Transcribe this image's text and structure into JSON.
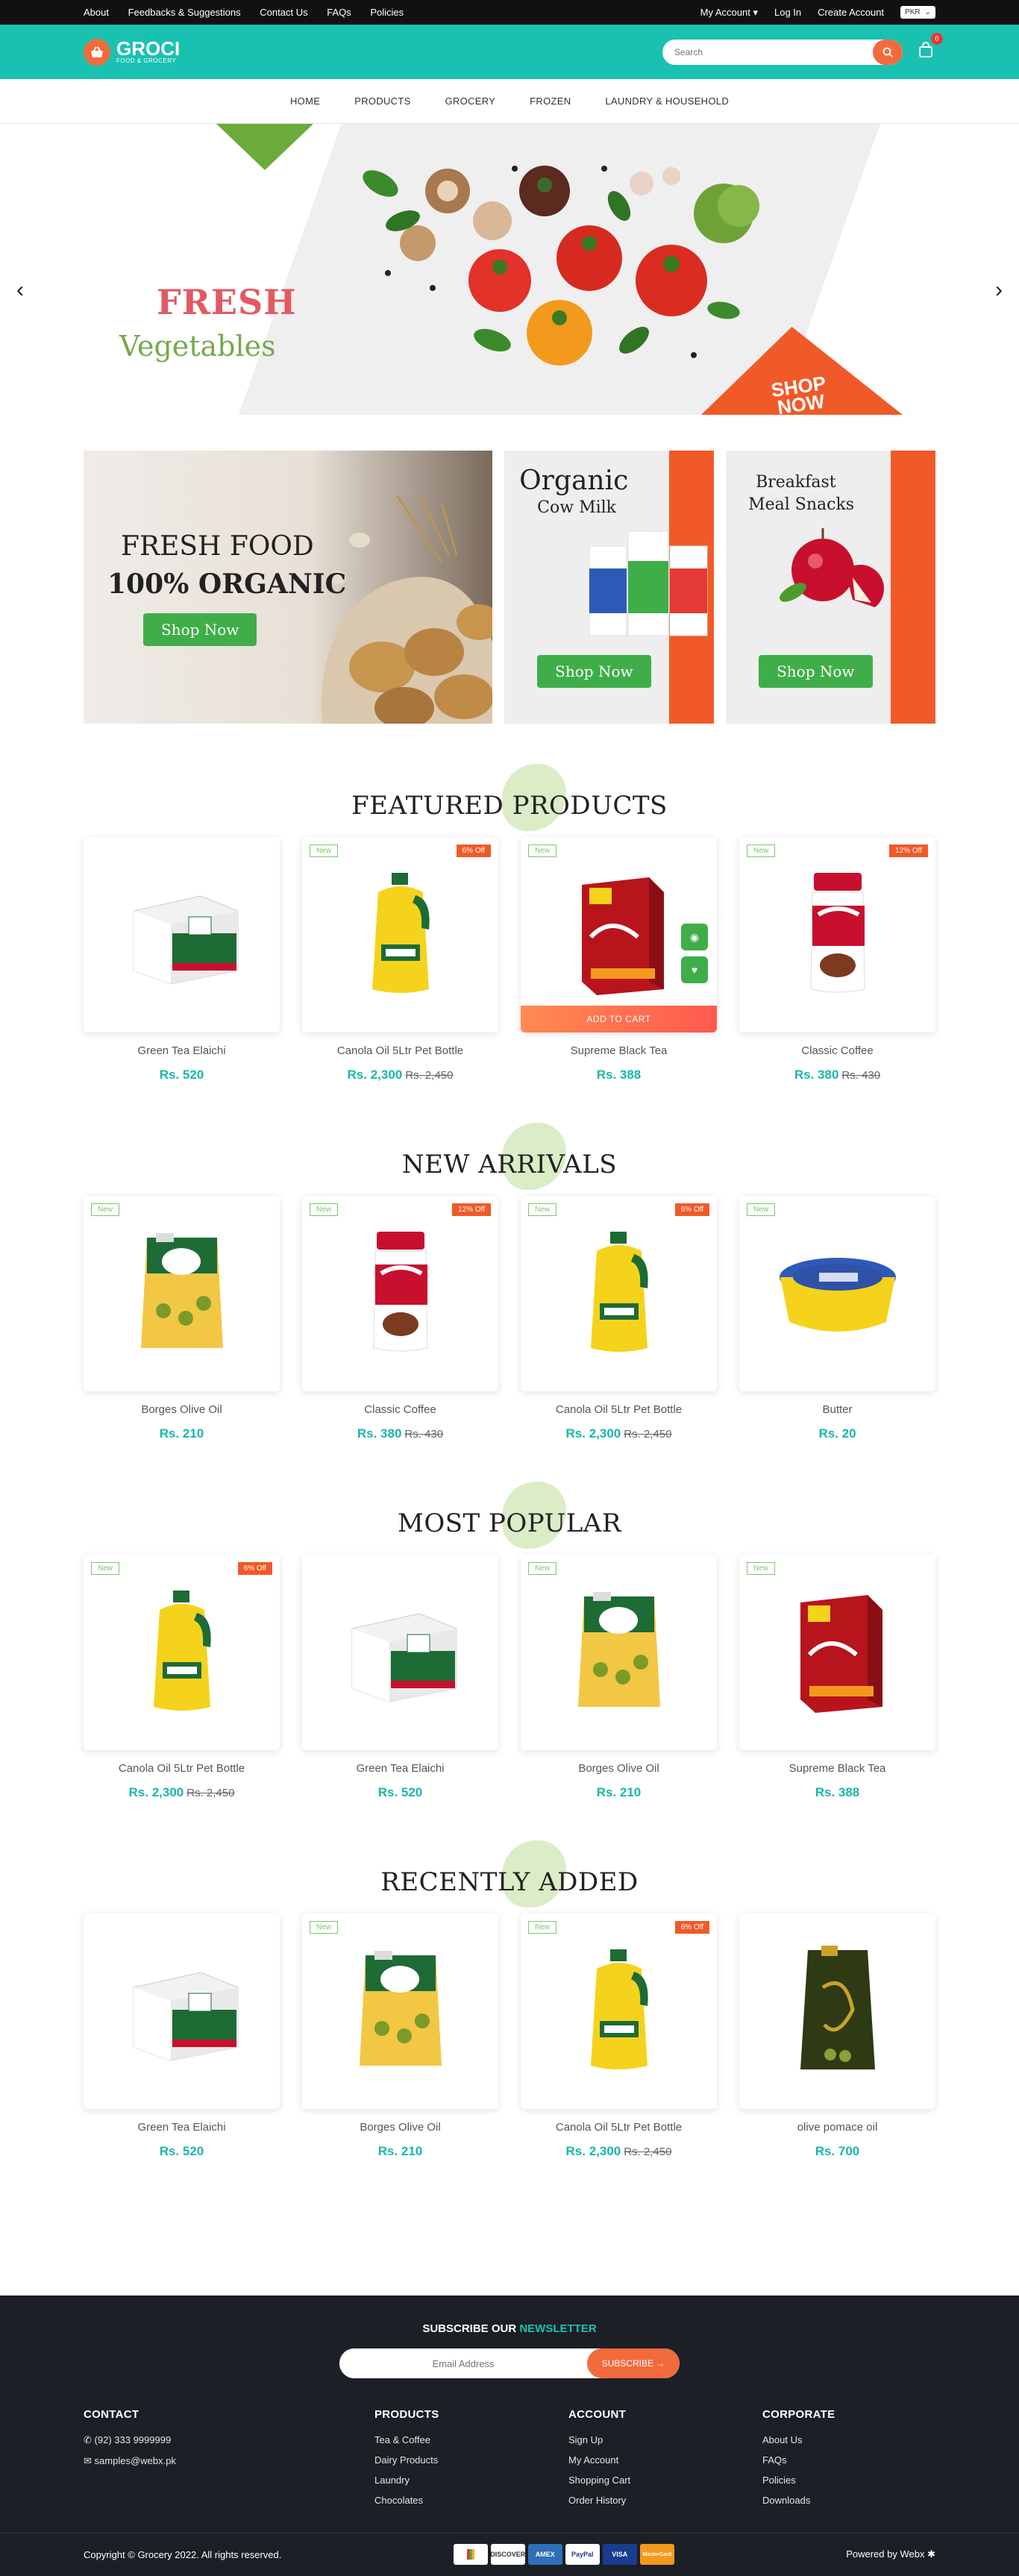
{
  "topbar": {
    "links": [
      "About",
      "Feedbacks & Suggestions",
      "Contact Us",
      "FAQs",
      "Policies"
    ],
    "my_account": "My Account",
    "login": "Log In",
    "create_account": "Create Account",
    "currency": "PKR"
  },
  "header": {
    "logo_name": "GROCI",
    "logo_sub": "FOOD & GROCERY",
    "search_placeholder": "Search",
    "cart_count": "0"
  },
  "nav": [
    "HOME",
    "PRODUCTS",
    "GROCERY",
    "FROZEN",
    "LAUNDRY & HOUSEHOLD"
  ],
  "hero": {
    "title": "FRESH",
    "subtitle": "Vegetables",
    "cta": "SHOP NOW"
  },
  "promos": [
    {
      "line1": "FRESH FOOD",
      "line2": "100% ORGANIC",
      "button": "Shop Now"
    },
    {
      "line1": "Organic",
      "line2": "Cow Milk",
      "button": "Shop Now"
    },
    {
      "line1": "Breakfast",
      "line2": "Meal Snacks",
      "button": "Shop Now"
    }
  ],
  "labels": {
    "add_to_cart": "ADD TO CART"
  },
  "sections": [
    {
      "title": "FEATURED PRODUCTS",
      "products": [
        {
          "name": "Green Tea Elaichi",
          "price": "Rs. 520",
          "old": "",
          "new": "",
          "off": "",
          "img": "butter-box"
        },
        {
          "name": "Canola Oil 5Ltr Pet Bottle",
          "price": "Rs. 2,300",
          "old": "Rs. 2,450",
          "new": "New",
          "off": "6% Off",
          "img": "oil-bottle"
        },
        {
          "name": "Supreme Black Tea",
          "price": "Rs. 388",
          "old": "",
          "new": "New",
          "off": "",
          "img": "tea-box"
        },
        {
          "name": "Classic Coffee",
          "price": "Rs. 380",
          "old": "Rs. 430",
          "new": "New",
          "off": "12% Off",
          "img": "coffee-jar"
        }
      ]
    },
    {
      "title": "NEW ARRIVALS",
      "products": [
        {
          "name": "Borges Olive Oil",
          "price": "Rs. 210",
          "old": "",
          "new": "New",
          "off": "",
          "img": "olive-pouch"
        },
        {
          "name": "Classic Coffee",
          "price": "Rs. 380",
          "old": "Rs. 430",
          "new": "New",
          "off": "12% Off",
          "img": "coffee-jar"
        },
        {
          "name": "Canola Oil 5Ltr Pet Bottle",
          "price": "Rs. 2,300",
          "old": "Rs. 2,450",
          "new": "New",
          "off": "6% Off",
          "img": "oil-bottle"
        },
        {
          "name": "Butter",
          "price": "Rs. 20",
          "old": "",
          "new": "New",
          "off": "",
          "img": "butter-tub"
        }
      ]
    },
    {
      "title": "MOST POPULAR",
      "products": [
        {
          "name": "Canola Oil 5Ltr Pet Bottle",
          "price": "Rs. 2,300",
          "old": "Rs. 2,450",
          "new": "New",
          "off": "6% Off",
          "img": "oil-bottle"
        },
        {
          "name": "Green Tea Elaichi",
          "price": "Rs. 520",
          "old": "",
          "new": "",
          "off": "",
          "img": "butter-box"
        },
        {
          "name": "Borges Olive Oil",
          "price": "Rs. 210",
          "old": "",
          "new": "New",
          "off": "",
          "img": "olive-pouch"
        },
        {
          "name": "Supreme Black Tea",
          "price": "Rs. 388",
          "old": "",
          "new": "New",
          "off": "",
          "img": "tea-box"
        }
      ]
    },
    {
      "title": "RECENTLY ADDED",
      "products": [
        {
          "name": "Green Tea Elaichi",
          "price": "Rs. 520",
          "old": "",
          "new": "",
          "off": "",
          "img": "butter-box"
        },
        {
          "name": "Borges Olive Oil",
          "price": "Rs. 210",
          "old": "",
          "new": "New",
          "off": "",
          "img": "olive-pouch"
        },
        {
          "name": "Canola Oil 5Ltr Pet Bottle",
          "price": "Rs. 2,300",
          "old": "Rs. 2,450",
          "new": "New",
          "off": "6% Off",
          "img": "oil-bottle"
        },
        {
          "name": "olive pomace oil",
          "price": "Rs. 700",
          "old": "",
          "new": "",
          "off": "",
          "img": "pomace-pouch"
        }
      ]
    }
  ],
  "footer": {
    "subscribe_a": "SUBSCRIBE OUR ",
    "subscribe_b": "NEWSLETTER",
    "email_placeholder": "Email Address",
    "subscribe_btn": "SUBSCRIBE →",
    "contact_title": "CONTACT",
    "phone": "(92) 333 9999999",
    "email": "samples@webx.pk",
    "columns": [
      {
        "title": "PRODUCTS",
        "items": [
          "Tea & Coffee",
          "Dairy Products",
          "Laundry",
          "Chocolates"
        ]
      },
      {
        "title": "ACCOUNT",
        "items": [
          "Sign Up",
          "My Account",
          "Shopping Cart",
          "Order History"
        ]
      },
      {
        "title": "CORPORATE",
        "items": [
          "About Us",
          "FAQs",
          "Policies",
          "Downloads"
        ]
      }
    ],
    "copyright": "Copyright © Grocery 2022. All rights reserved.",
    "powered": "Powered by Webx",
    "payment_cards": [
      "",
      "DISCOVER",
      "AMEX",
      "PayPal",
      "VISA",
      "MasterCard"
    ]
  }
}
